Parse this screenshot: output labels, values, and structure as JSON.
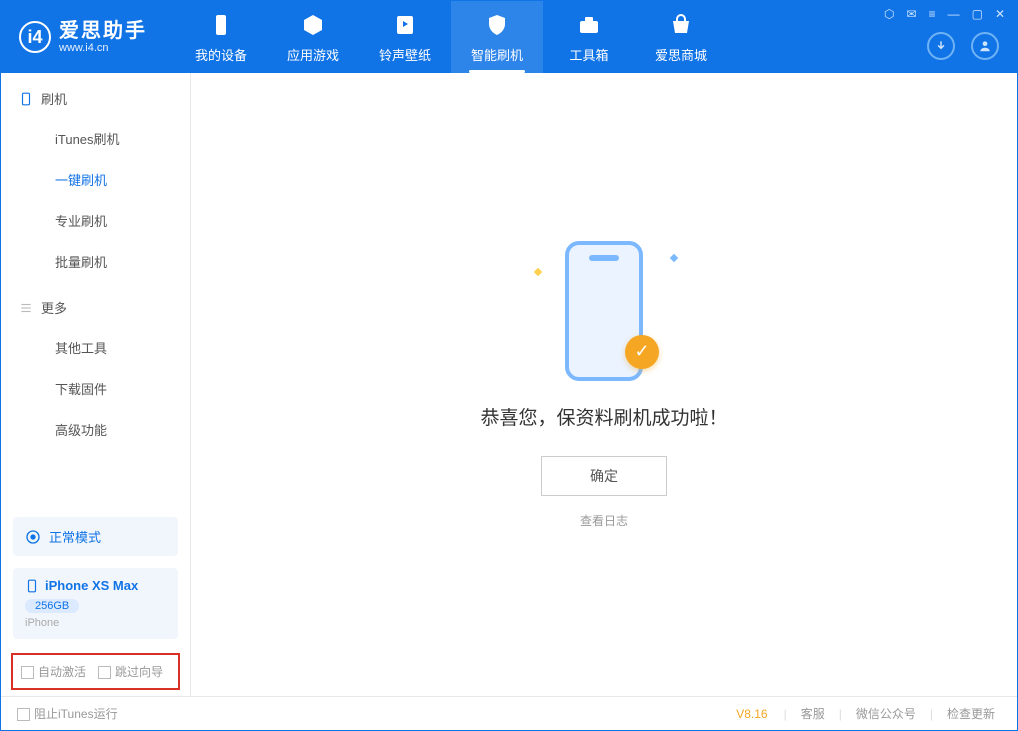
{
  "app": {
    "title": "爱思助手",
    "subtitle": "www.i4.cn"
  },
  "nav": {
    "tabs": [
      {
        "label": "我的设备"
      },
      {
        "label": "应用游戏"
      },
      {
        "label": "铃声壁纸"
      },
      {
        "label": "智能刷机"
      },
      {
        "label": "工具箱"
      },
      {
        "label": "爱思商城"
      }
    ]
  },
  "sidebar": {
    "section1_title": "刷机",
    "items1": [
      {
        "label": "iTunes刷机"
      },
      {
        "label": "一键刷机"
      },
      {
        "label": "专业刷机"
      },
      {
        "label": "批量刷机"
      }
    ],
    "section2_title": "更多",
    "items2": [
      {
        "label": "其他工具"
      },
      {
        "label": "下载固件"
      },
      {
        "label": "高级功能"
      }
    ],
    "mode": "正常模式",
    "device": {
      "name": "iPhone XS Max",
      "storage": "256GB",
      "type": "iPhone"
    },
    "opt_auto_activate": "自动激活",
    "opt_skip_guide": "跳过向导"
  },
  "main": {
    "success_text": "恭喜您，保资料刷机成功啦！",
    "ok_button": "确定",
    "view_log": "查看日志"
  },
  "footer": {
    "block_itunes": "阻止iTunes运行",
    "version": "V8.16",
    "links": [
      "客服",
      "微信公众号",
      "检查更新"
    ]
  }
}
